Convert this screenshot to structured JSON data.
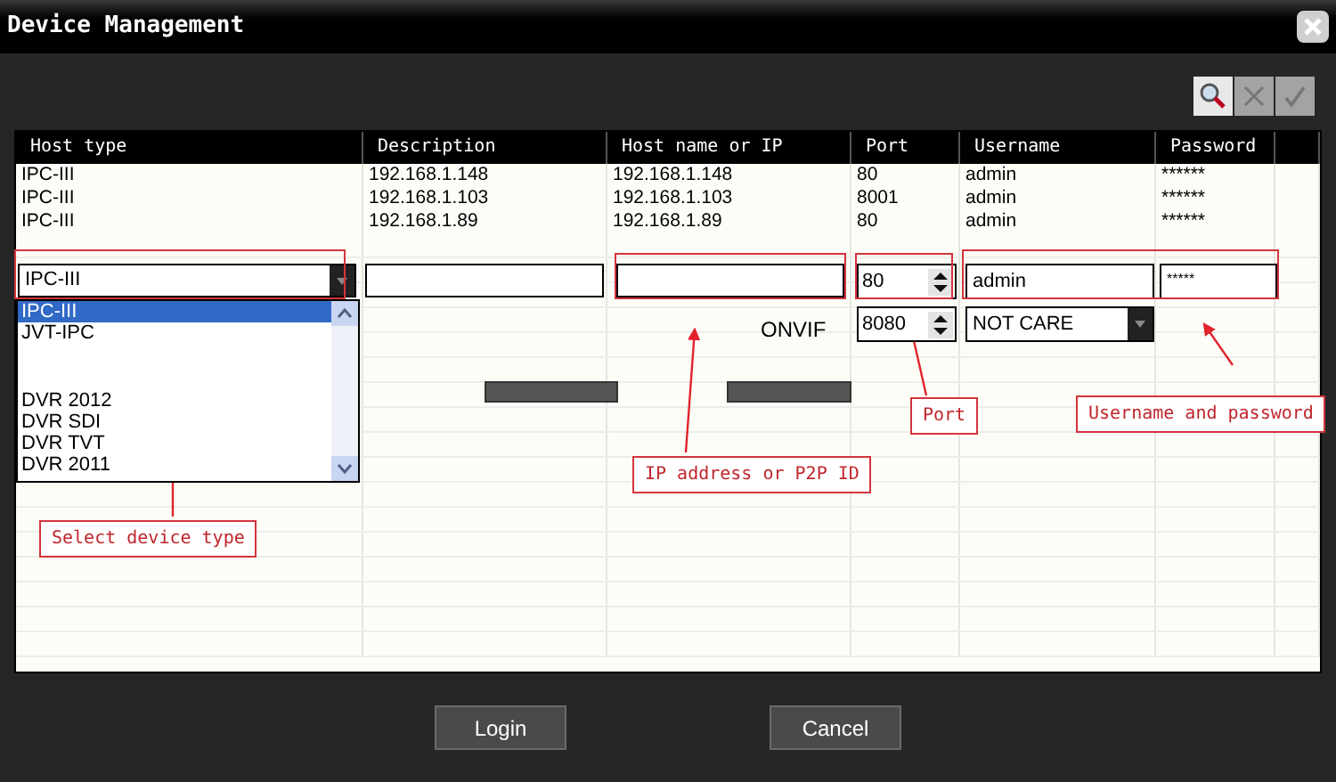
{
  "window": {
    "title": "Device Management"
  },
  "toolbar": [
    {
      "kind": "search",
      "disabled": false
    },
    {
      "kind": "delete",
      "disabled": true
    },
    {
      "kind": "confirm",
      "disabled": true
    }
  ],
  "table": {
    "columns": [
      "Host type",
      "Description",
      "Host name or IP",
      "Port",
      "Username",
      "Password"
    ],
    "rows": [
      {
        "cells": [
          "IPC-III",
          "192.168.1.148",
          "192.168.1.148",
          "80",
          "admin",
          "******"
        ]
      },
      {
        "cells": [
          "IPC-III",
          "192.168.1.103",
          "192.168.1.103",
          "8001",
          "admin",
          "******"
        ]
      },
      {
        "cells": [
          "IPC-III",
          "192.168.1.89",
          "192.168.1.89",
          "80",
          "admin",
          "******"
        ]
      }
    ]
  },
  "editor": {
    "host_type": {
      "value": "IPC-III",
      "options": [
        {
          "label": "IPC-III",
          "selected": true
        },
        {
          "label": "JVT-IPC",
          "selected": false
        },
        {
          "label": "DVR 2012",
          "selected": false
        },
        {
          "label": "DVR SDI",
          "selected": false
        },
        {
          "label": "DVR TVT",
          "selected": false
        },
        {
          "label": "DVR 2011",
          "selected": false
        }
      ]
    },
    "port": "80",
    "username": "admin",
    "password": "*****",
    "onvif": {
      "label": "ONVIF",
      "port": "8080",
      "auth": "NOT CARE"
    },
    "actions": [
      {
        "kind": "blank"
      },
      {
        "kind": "blank"
      }
    ]
  },
  "annotations": [
    {
      "text": "Select device type"
    },
    {
      "text": "IP address or P2P ID"
    },
    {
      "text": "Port"
    },
    {
      "text": "Username and password"
    }
  ],
  "buttons": [
    "Login",
    "Cancel"
  ]
}
